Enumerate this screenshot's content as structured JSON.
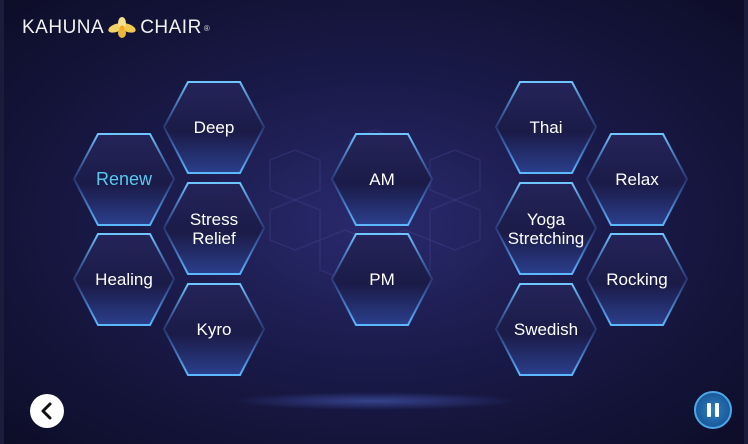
{
  "brand": {
    "left": "KAHUNA",
    "right": "CHAIR",
    "reg": "®",
    "logo_icon": "flower-icon"
  },
  "programs": {
    "left": [
      {
        "id": "deep",
        "label": "Deep",
        "active": false
      },
      {
        "id": "renew",
        "label": "Renew",
        "active": true
      },
      {
        "id": "stress-relief",
        "label": "Stress\nRelief",
        "active": false
      },
      {
        "id": "healing",
        "label": "Healing",
        "active": false
      },
      {
        "id": "kyro",
        "label": "Kyro",
        "active": false
      }
    ],
    "center": [
      {
        "id": "am",
        "label": "AM",
        "active": false
      },
      {
        "id": "pm",
        "label": "PM",
        "active": false
      }
    ],
    "right": [
      {
        "id": "thai",
        "label": "Thai",
        "active": false
      },
      {
        "id": "relax",
        "label": "Relax",
        "active": false
      },
      {
        "id": "yoga-stretching",
        "label": "Yoga\nStretching",
        "active": false
      },
      {
        "id": "rocking",
        "label": "Rocking",
        "active": false
      },
      {
        "id": "swedish",
        "label": "Swedish",
        "active": false
      }
    ]
  },
  "controls": {
    "back_icon": "chevron-left-icon",
    "pause_icon": "pause-icon"
  },
  "colors": {
    "active_label": "#59c8f0",
    "hex_edge": "#4ab0f0",
    "background": "#1a1a4a"
  }
}
